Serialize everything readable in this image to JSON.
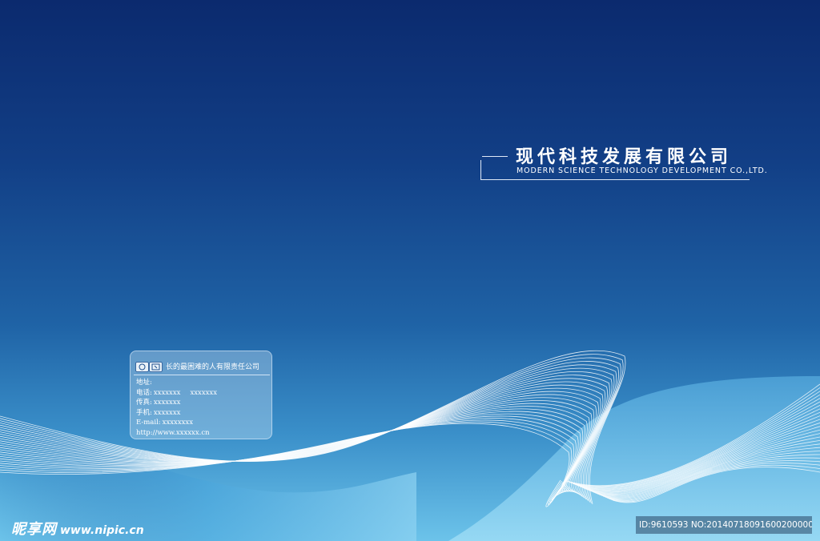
{
  "company": {
    "name_cn": "现代科技发展有限公司",
    "name_en": "MODERN SCIENCE TECHNOLOGY DEVELOPMENT CO.,LTD."
  },
  "contact_card": {
    "company_name": "长的最困难的人有限责任公司",
    "rows": [
      {
        "label": "地址:",
        "value": "",
        "value2": ""
      },
      {
        "label": "电话:",
        "value": "xxxxxxx",
        "value2": "xxxxxxx"
      },
      {
        "label": "传真:",
        "value": "xxxxxxx",
        "value2": ""
      },
      {
        "label": "手机:",
        "value": "xxxxxxx",
        "value2": ""
      },
      {
        "label": "E-mail:",
        "value": "xxxxxxxx",
        "value2": ""
      },
      {
        "label": "",
        "value": "http://www.xxxxxx.cn",
        "value2": ""
      }
    ]
  },
  "watermark": {
    "brand": "昵享网",
    "url": "www.nipic.cn",
    "id_text": "ID:9610593 NO:20140718091600200000"
  },
  "colors": {
    "top": "#0b2a6e",
    "middle": "#1f63a6",
    "bottom": "#6cc3ea",
    "lines": "#ffffff"
  }
}
